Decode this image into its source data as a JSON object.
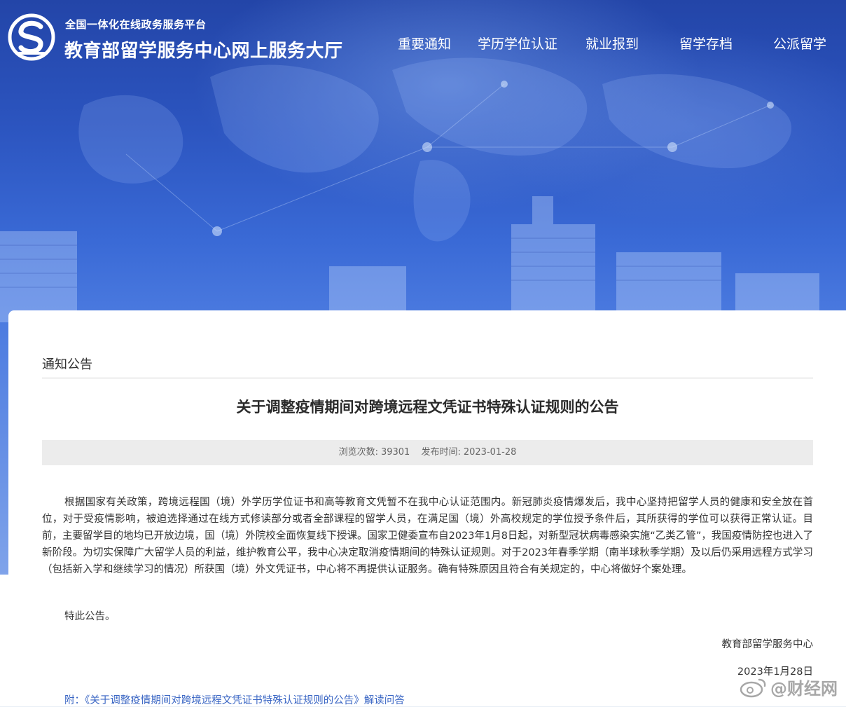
{
  "header": {
    "platform_label": "全国一体化在线政务服务平台",
    "site_title": "教育部留学服务中心网上服务大厅",
    "nav": [
      {
        "label": "重要通知"
      },
      {
        "label": "学历学位认证"
      },
      {
        "label": "就业报到"
      },
      {
        "label": "留学存档"
      },
      {
        "label": "公派留学"
      }
    ]
  },
  "article": {
    "section": "通知公告",
    "title": "关于调整疫情期间对跨境远程文凭证书特殊认证规则的公告",
    "views_label": "浏览次数:",
    "views": "39301",
    "published_label": "发布时间:",
    "published": "2023-01-28",
    "body": "根据国家有关政策，跨境远程国（境）外学历学位证书和高等教育文凭暂不在我中心认证范围内。新冠肺炎疫情爆发后，我中心坚持把留学人员的健康和安全放在首位，对于受疫情影响，被迫选择通过在线方式修读部分或者全部课程的留学人员，在满足国（境）外高校规定的学位授予条件后，其所获得的学位可以获得正常认证。目前，主要留学目的地均已开放边境，国（境）外院校全面恢复线下授课。国家卫健委宣布自2023年1月8日起，对新型冠状病毒感染实施“乙类乙管”，我国疫情防控也进入了新阶段。为切实保障广大留学人员的利益，维护教育公平，我中心决定取消疫情期间的特殊认证规则。对于2023年春季学期（南半球秋季学期）及以后仍采用远程方式学习（包括新入学和继续学习的情况）所获国（境）外文凭证书，中心将不再提供认证服务。确有特殊原因且符合有关规定的，中心将做好个案处理。",
    "closing": "特此公告。",
    "signature": "教育部留学服务中心",
    "sign_date": "2023年1月28日",
    "attachment": "附：《关于调整疫情期间对跨境远程文凭证书特殊认证规则的公告》解读问答"
  },
  "watermark": {
    "text": "@财经网",
    "icon": "weibo-icon"
  },
  "colors": {
    "hero_blue": "#2c55c0",
    "link_blue": "#3a66c4",
    "meta_bg": "#ececec"
  }
}
